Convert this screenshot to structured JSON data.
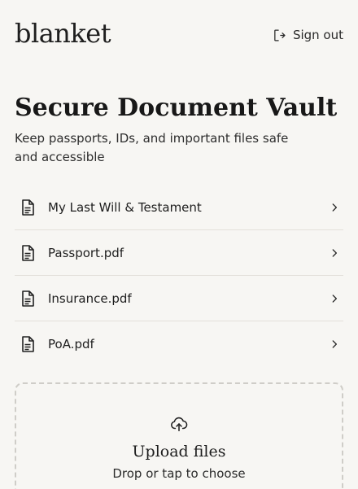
{
  "header": {
    "brand": "blanket",
    "signout_label": "Sign out",
    "signout_icon": "sign-out-icon"
  },
  "main": {
    "title": "Secure Document Vault",
    "subtitle": "Keep passports, IDs, and important files safe and accessible",
    "documents": [
      {
        "label": "My Last Will & Testament",
        "icon": "document-icon"
      },
      {
        "label": "Passport.pdf",
        "icon": "document-icon"
      },
      {
        "label": "Insurance.pdf",
        "icon": "document-icon"
      },
      {
        "label": "PoA.pdf",
        "icon": "document-icon"
      }
    ]
  },
  "upload": {
    "title": "Upload files",
    "subtitle": "Drop or tap to choose",
    "icon": "cloud-upload-icon"
  },
  "colors": {
    "background": "#f7f6f3",
    "text": "#1f1f1f",
    "divider": "#e3e0da",
    "dashed_border": "#cfcdc8"
  }
}
